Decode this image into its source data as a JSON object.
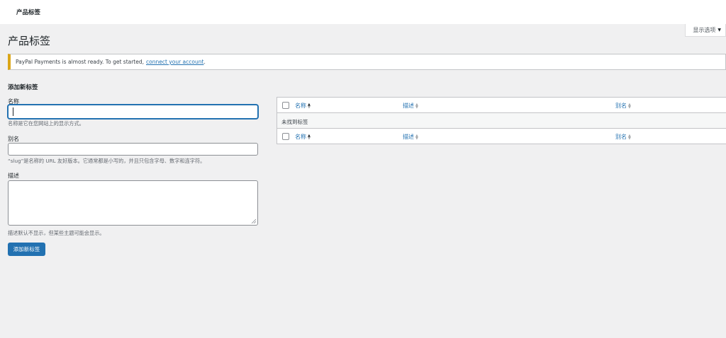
{
  "topbar": {
    "breadcrumb": "产品标签"
  },
  "screen_options": {
    "label": "显示选项"
  },
  "page": {
    "title": "产品标签"
  },
  "notice": {
    "text": "PayPal Payments is almost ready. To get started,",
    "link": "connect your account",
    "suffix": "."
  },
  "form": {
    "title": "添加新标签",
    "name_label": "名称",
    "name_value": "",
    "name_hint": "名称是它在您网站上的显示方式。",
    "slug_label": "别名",
    "slug_value": "",
    "slug_hint": "“slug”是名称的 URL 友好版本。它通常都是小写的，并且只包含字母、数字和连字符。",
    "desc_label": "描述",
    "desc_value": "",
    "desc_hint": "描述默认不显示，但某些主题可能会显示。",
    "submit_label": "添加新标签"
  },
  "table": {
    "columns": [
      "名称",
      "描述",
      "别名"
    ],
    "empty_message": "未找到标签"
  },
  "colors": {
    "accent": "#2271b1",
    "notice_warning": "#dba617",
    "background": "#f0f0f1"
  },
  "icons": {
    "sort": "sort-arrows-icon",
    "dropdown": "caret-down-icon"
  }
}
